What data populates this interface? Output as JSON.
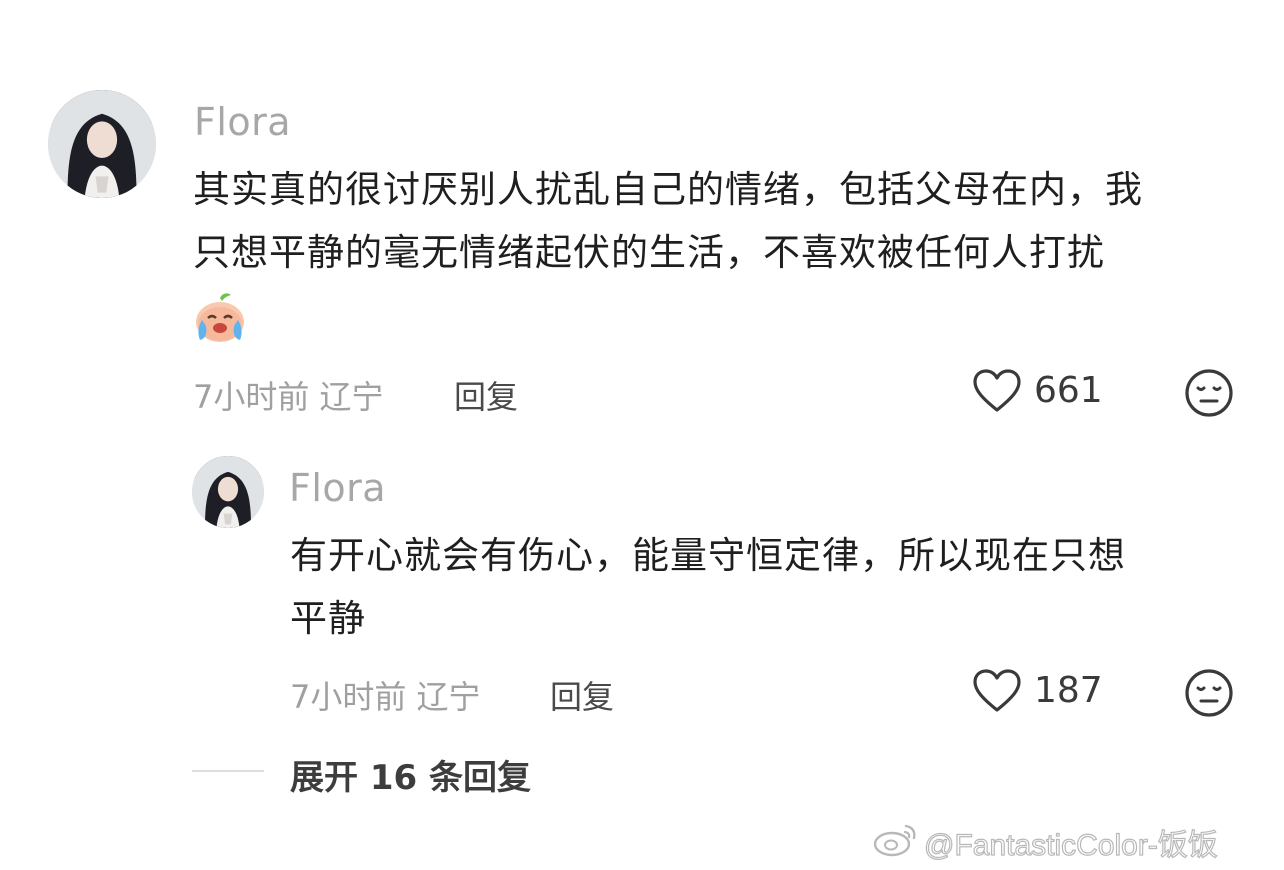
{
  "comment": {
    "username": "Flora",
    "text_line1": "其实真的很讨厌别人扰乱自己的情绪，包括父母在内，我",
    "text_line2": "只想平静的毫无情绪起伏的生活，不喜欢被任何人打扰",
    "emoji": "crying-peach-emoji",
    "time_location": "7小时前 辽宁",
    "reply_label": "回复",
    "like_count": "661"
  },
  "reply": {
    "username": "Flora",
    "text_line1": "有开心就会有伤心，能量守恒定律，所以现在只想",
    "text_line2": "平静",
    "time_location": "7小时前 辽宁",
    "reply_label": "回复",
    "like_count": "187"
  },
  "expand_replies_label": "展开 16 条回复",
  "watermark": "@FantasticColor-饭饭",
  "icons": {
    "like": "heart-icon",
    "dislike": "neutral-face-icon",
    "watermark_logo": "weibo-logo-icon"
  },
  "colors": {
    "username": "#a7a7a7",
    "text": "#1f1f1f",
    "meta": "#a0a0a0"
  }
}
